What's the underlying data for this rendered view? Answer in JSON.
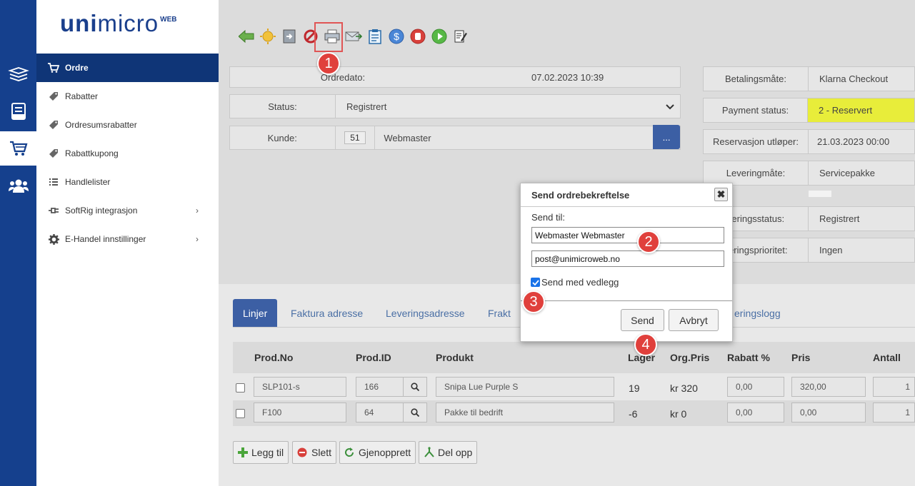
{
  "logo": {
    "part1": "uni",
    "part2": "micro",
    "part3": "WEB"
  },
  "icon_sidebar": {
    "items": [
      "orders-stack-icon",
      "invoice-icon",
      "cart-icon",
      "users-icon"
    ],
    "active": "cart-icon"
  },
  "sidebar": {
    "items": [
      {
        "label": "Ordre",
        "icon": "cart-icon",
        "active": true
      },
      {
        "label": "Rabatter",
        "icon": "tag-icon"
      },
      {
        "label": "Ordresumsrabatter",
        "icon": "tag-icon"
      },
      {
        "label": "Rabattkupong",
        "icon": "tag-icon"
      },
      {
        "label": "Handlelister",
        "icon": "list-icon"
      },
      {
        "label": "SoftRig integrasjon",
        "icon": "plug-icon",
        "chevron": "›"
      },
      {
        "label": "E-Handel innstillinger",
        "icon": "gear-icon",
        "chevron": "›"
      }
    ]
  },
  "toolbar": {
    "icons": [
      "back-arrow-icon",
      "sun-icon",
      "import-icon",
      "cancel-icon",
      "print-icon",
      "send-icon",
      "clipboard-icon",
      "dollar-icon",
      "stop-icon",
      "play-icon",
      "edit-icon"
    ]
  },
  "order": {
    "date_label": "Ordredato:",
    "date_value": "07.02.2023 10:39",
    "status_label": "Status:",
    "status_value": "Registrert",
    "customer_label": "Kunde:",
    "customer_id": "51",
    "customer_name": "Webmaster",
    "customer_btn": "..."
  },
  "payment": {
    "method_label": "Betalingsmåte:",
    "method_value": "Klarna Checkout",
    "status_label": "Payment status:",
    "status_value": "2 - Reservert",
    "expires_label": "Reservasjon utløper:",
    "expires_value": "21.03.2023 00:00",
    "delivery_label": "Leveringmåte:",
    "delivery_value": "Servicepakke",
    "dstatus_label": "veringsstatus:",
    "dstatus_value": "Registrert",
    "dprio_label": "veringsprioritet:",
    "dprio_value": "Ingen"
  },
  "tabs": [
    "Linjer",
    "Faktura adresse",
    "Leveringsadresse",
    "Frakt",
    "eringslogg"
  ],
  "table": {
    "headers": [
      "Prod.No",
      "Prod.ID",
      "Produkt",
      "Lager",
      "Org.Pris",
      "Rabatt %",
      "Pris",
      "Antall"
    ],
    "rows": [
      {
        "prodno": "SLP101-s",
        "prodid": "166",
        "produkt": "Snipa Lue Purple S",
        "lager": "19",
        "orgpris": "kr 320",
        "rabatt": "0,00",
        "pris": "320,00",
        "antall": "1"
      },
      {
        "prodno": "F100",
        "prodid": "64",
        "produkt": "Pakke til bedrift",
        "lager": "-6",
        "orgpris": "kr 0",
        "rabatt": "0,00",
        "pris": "0,00",
        "antall": "1"
      }
    ]
  },
  "actions": {
    "add": "Legg til",
    "delete": "Slett",
    "restore": "Gjenopprett",
    "split": "Del opp"
  },
  "modal": {
    "title": "Send ordrebekreftelse",
    "close": "✖",
    "send_to_label": "Send til:",
    "name_value": "Webmaster Webmaster",
    "email_value": "post@unimicroweb.no",
    "attach_label": "Send med vedlegg",
    "attach_checked": true,
    "send_btn": "Send",
    "cancel_btn": "Avbryt"
  },
  "markers": [
    "1",
    "2",
    "3",
    "4"
  ],
  "colors": {
    "brand": "#15408d",
    "active_nav": "#0f3577",
    "highlight": "#e8ed3a",
    "marker": "#e0403c",
    "button_blue": "#3c5fa4"
  }
}
